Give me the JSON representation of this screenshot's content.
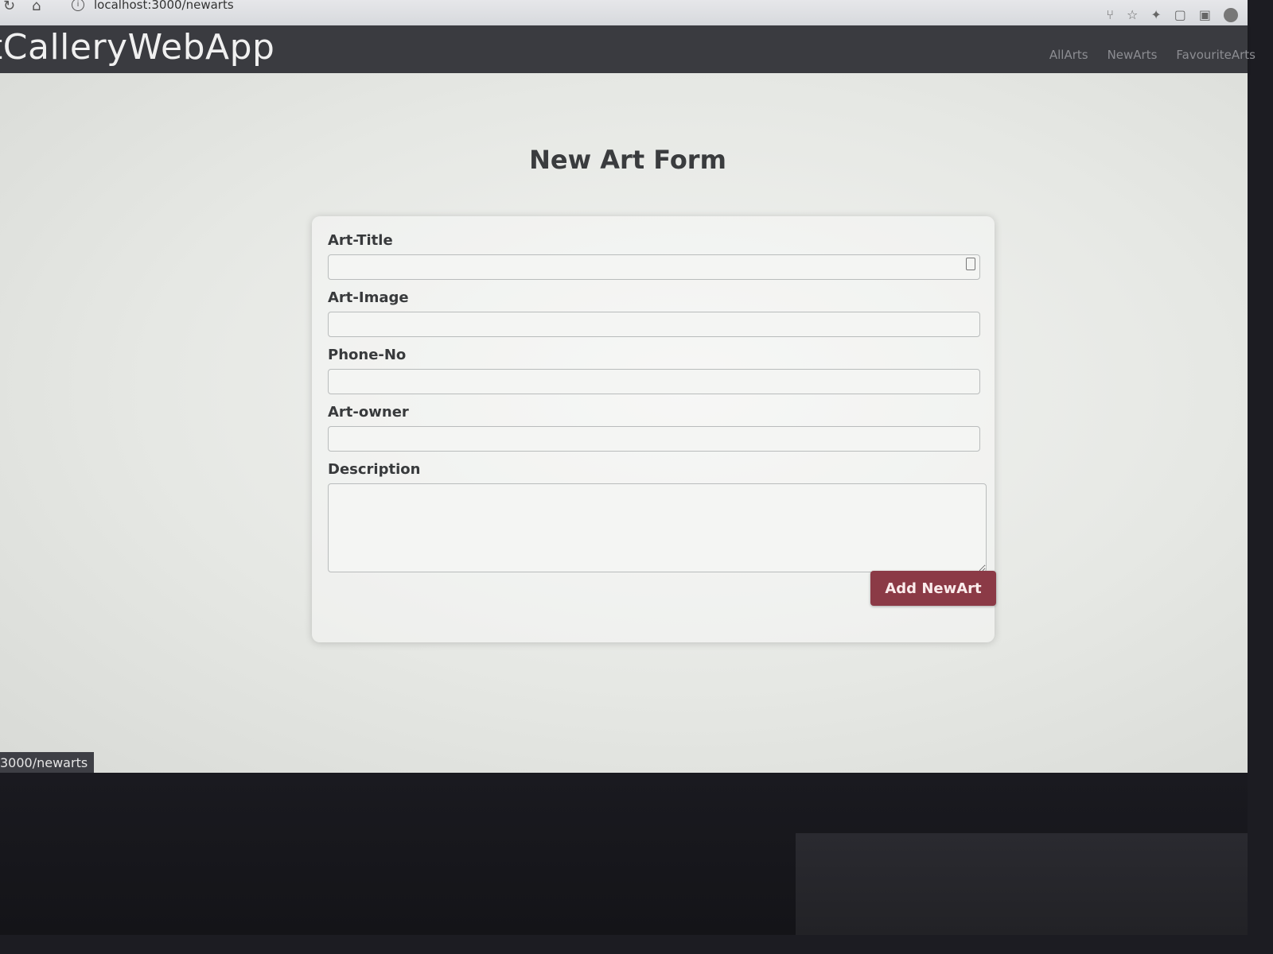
{
  "browser": {
    "url": "localhost:3000/newarts",
    "icons": [
      "reload-icon",
      "home-icon",
      "site-info-icon",
      "share-icon",
      "bookmark-star-icon",
      "extensions-icon",
      "tab-search-icon",
      "sidebar-icon",
      "profile-icon"
    ]
  },
  "navbar": {
    "brand": "tCalleryWebApp",
    "links": [
      {
        "label": "AllArts"
      },
      {
        "label": "NewArts"
      },
      {
        "label": "FavouriteArts"
      }
    ]
  },
  "form": {
    "title": "New Art Form",
    "fields": [
      {
        "label": "Art-Title",
        "value": ""
      },
      {
        "label": "Art-Image",
        "value": ""
      },
      {
        "label": "Phone-No",
        "value": ""
      },
      {
        "label": "Art-owner",
        "value": ""
      },
      {
        "label": "Description",
        "value": ""
      }
    ],
    "submit_label": "Add NewArt"
  },
  "status_bar": {
    "link_preview": "3000/newarts"
  },
  "colors": {
    "navbar_bg": "#3a3b40",
    "button_bg": "#8b3a46",
    "page_bg": "#e9eae7"
  }
}
